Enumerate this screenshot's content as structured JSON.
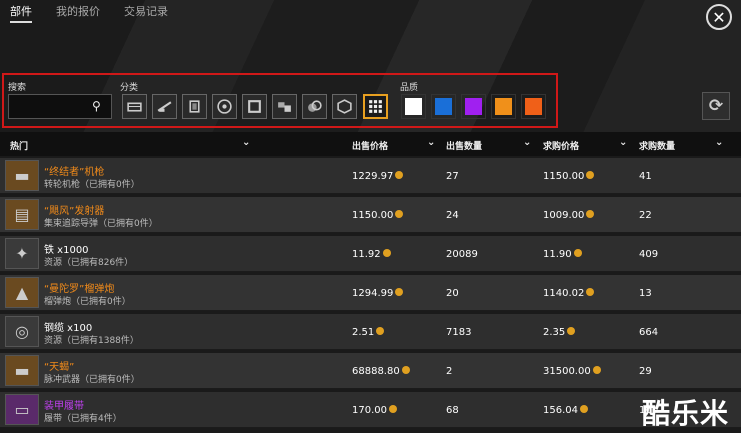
{
  "tabs": [
    "部件",
    "我的报价",
    "交易记录"
  ],
  "close_symbol": "✕",
  "filters": {
    "search_label": "搜索",
    "search_placeholder": "",
    "category_label": "分类",
    "quality_label": "品质",
    "categories": [
      "cabin-icon",
      "gun-icon",
      "armor-icon",
      "wheel-icon",
      "frame-icon",
      "module-icon",
      "resource-icon",
      "hex-icon",
      "all-grid-icon"
    ],
    "active_category": "all-grid-icon",
    "qualities": [
      "#ffffff",
      "#1a6fd8",
      "#a020f0",
      "#f0901a",
      "#f06018"
    ]
  },
  "refresh_symbol": "⟳",
  "table": {
    "headers": {
      "name": "热门",
      "sell_price": "出售价格",
      "sell_qty": "出售数量",
      "buy_price": "求购价格",
      "buy_qty": "求购数量"
    },
    "rows": [
      {
        "name": "“终结者”机枪",
        "sub": "转轮机枪（已拥有0件）",
        "name_color": "orange",
        "sell_price": "1229.97",
        "sell_qty": "27",
        "buy_price": "1150.00",
        "buy_qty": "41",
        "icon": "gatling-icon",
        "thumb_bg": "#6a4a20"
      },
      {
        "name": "“飓风”发射器",
        "sub": "集束追踪导弹（已拥有0件）",
        "name_color": "orange",
        "sell_price": "1150.00",
        "sell_qty": "24",
        "buy_price": "1009.00",
        "buy_qty": "22",
        "icon": "launcher-icon",
        "thumb_bg": "#6a4a20"
      },
      {
        "name": "铁 x1000",
        "sub": "资源（已拥有826件）",
        "name_color": "white",
        "sell_price": "11.92",
        "sell_qty": "20089",
        "buy_price": "11.90",
        "buy_qty": "409",
        "icon": "iron-icon",
        "thumb_bg": "#3a3a3a"
      },
      {
        "name": "“曼陀罗”榴弹炮",
        "sub": "榴弹炮（已拥有0件）",
        "name_color": "orange",
        "sell_price": "1294.99",
        "sell_qty": "20",
        "buy_price": "1140.02",
        "buy_qty": "13",
        "icon": "howitzer-icon",
        "thumb_bg": "#6a4a20"
      },
      {
        "name": "钢缆 x100",
        "sub": "资源（已拥有1388件）",
        "name_color": "white",
        "sell_price": "2.51",
        "sell_qty": "7183",
        "buy_price": "2.35",
        "buy_qty": "664",
        "icon": "cable-icon",
        "thumb_bg": "#3a3a3a"
      },
      {
        "name": "“天蝎”",
        "sub": "脉冲武器（已拥有0件）",
        "name_color": "orange",
        "sell_price": "68888.80",
        "sell_qty": "2",
        "buy_price": "31500.00",
        "buy_qty": "29",
        "icon": "pulse-weapon-icon",
        "thumb_bg": "#6a4a20"
      },
      {
        "name": "装甲履带",
        "sub": "履带（已拥有4件）",
        "name_color": "purple",
        "sell_price": "170.00",
        "sell_qty": "68",
        "buy_price": "156.04",
        "buy_qty": "16",
        "icon": "track-icon",
        "thumb_bg": "#5a2a6a"
      }
    ]
  },
  "watermark": "酷乐米"
}
